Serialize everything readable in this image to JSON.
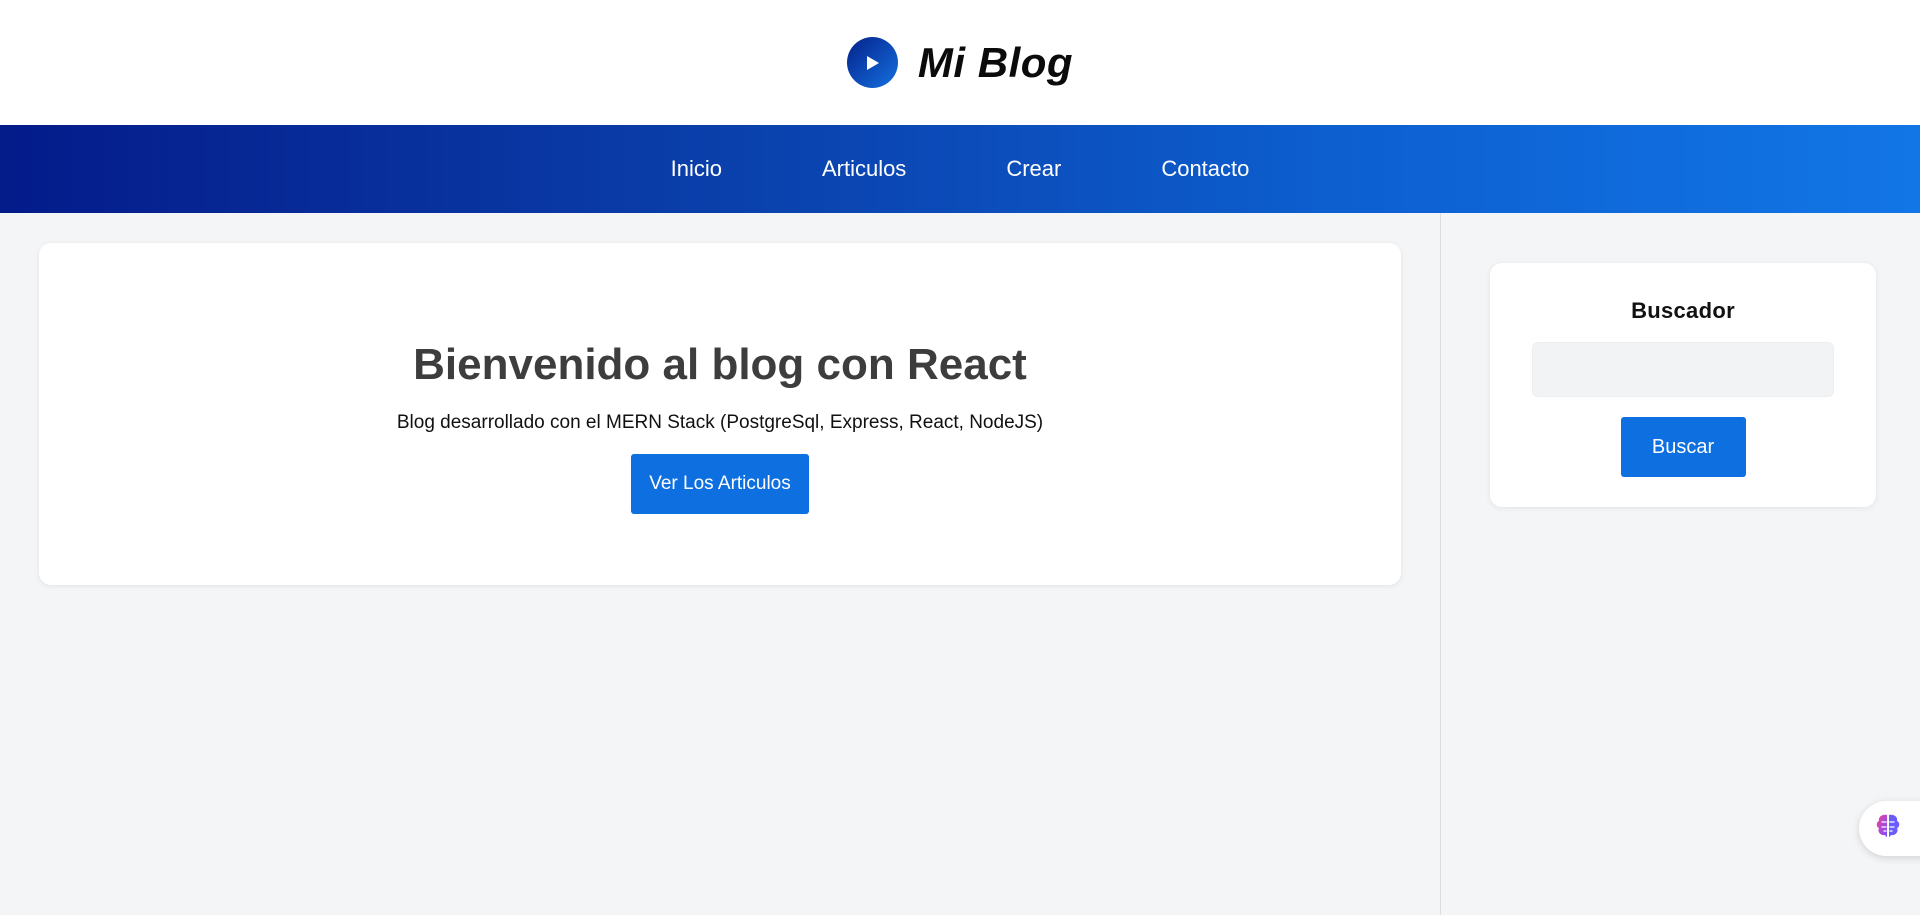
{
  "header": {
    "title": "Mi Blog",
    "logo_icon": "play-icon"
  },
  "nav": {
    "items": [
      {
        "label": "Inicio"
      },
      {
        "label": "Articulos"
      },
      {
        "label": "Crear"
      },
      {
        "label": "Contacto"
      }
    ]
  },
  "hero": {
    "title": "Bienvenido al blog con React",
    "subtitle": "Blog desarrollado con el MERN Stack (PostgreSql, Express, React, NodeJS)",
    "button_label": "Ver Los Articulos"
  },
  "sidebar": {
    "search_title": "Buscador",
    "search_value": "",
    "search_placeholder": "",
    "search_button_label": "Buscar"
  },
  "widget": {
    "icon": "brain-icon"
  },
  "colors": {
    "primary": "#0d6fe0",
    "nav_gradient_start": "#041b8a",
    "nav_gradient_end": "#1276e6",
    "background": "#f4f5f7"
  }
}
